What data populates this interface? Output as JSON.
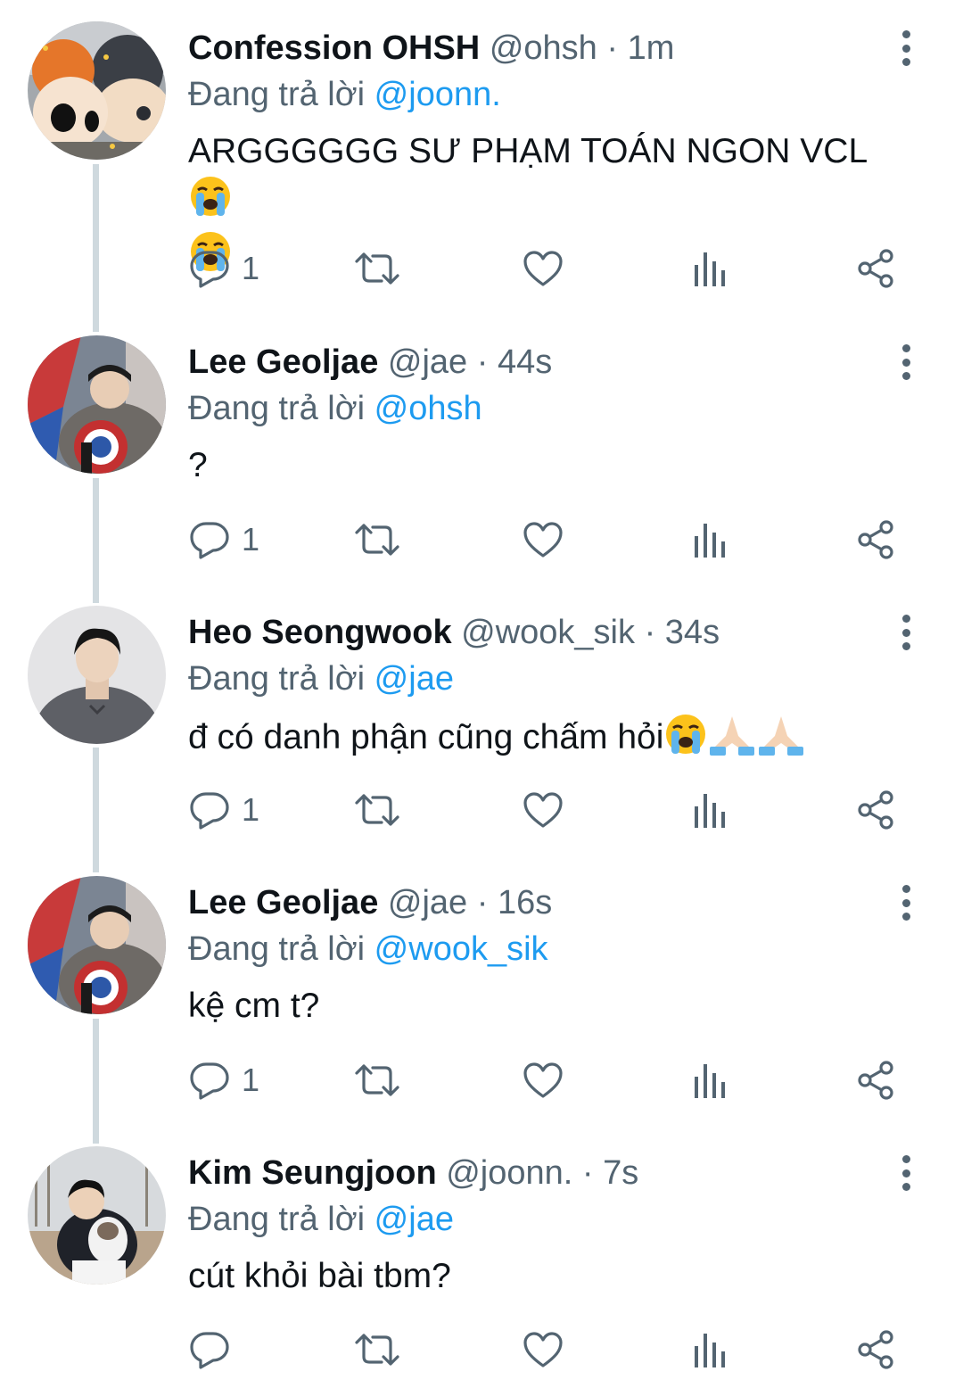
{
  "reply_prefix": "Đang trả lời",
  "tweets": [
    {
      "name": "Confession OHSH",
      "handle": "@ohsh",
      "time": "1m",
      "reply_to": "@joonn.",
      "text": "ARGGGGGG SƯ PHẠM TOÁN NGON VCL",
      "emojis": [
        "loudly-crying-face",
        "loudly-crying-face"
      ],
      "reply_count": "1"
    },
    {
      "name": "Lee Geoljae",
      "handle": "@jae",
      "time": "44s",
      "reply_to": "@ohsh",
      "text": "?",
      "emojis": [],
      "reply_count": "1"
    },
    {
      "name": "Heo Seongwook",
      "handle": "@wook_sik",
      "time": "34s",
      "reply_to": "@jae",
      "text": "đ có danh phận cũng chấm hỏi",
      "emojis": [
        "loudly-crying-face",
        "folded-hands-light",
        "folded-hands-light"
      ],
      "reply_count": "1"
    },
    {
      "name": "Lee Geoljae",
      "handle": "@jae",
      "time": "16s",
      "reply_to": "@wook_sik",
      "text": "kệ cm t?",
      "emojis": [],
      "reply_count": "1"
    },
    {
      "name": "Kim Seungjoon",
      "handle": "@joonn.",
      "time": "7s",
      "reply_to": "@jae",
      "text": "cút khỏi bài tbm?",
      "emojis": [],
      "reply_count": ""
    }
  ],
  "icons": {
    "reply": "reply-icon",
    "retweet": "retweet-icon",
    "like": "like-icon",
    "views": "views-icon",
    "share": "share-icon",
    "more": "more-options-icon"
  },
  "colors": {
    "mention": "#1d9bf0",
    "secondary_text": "#536471",
    "thread_line": "#cfd9de"
  }
}
